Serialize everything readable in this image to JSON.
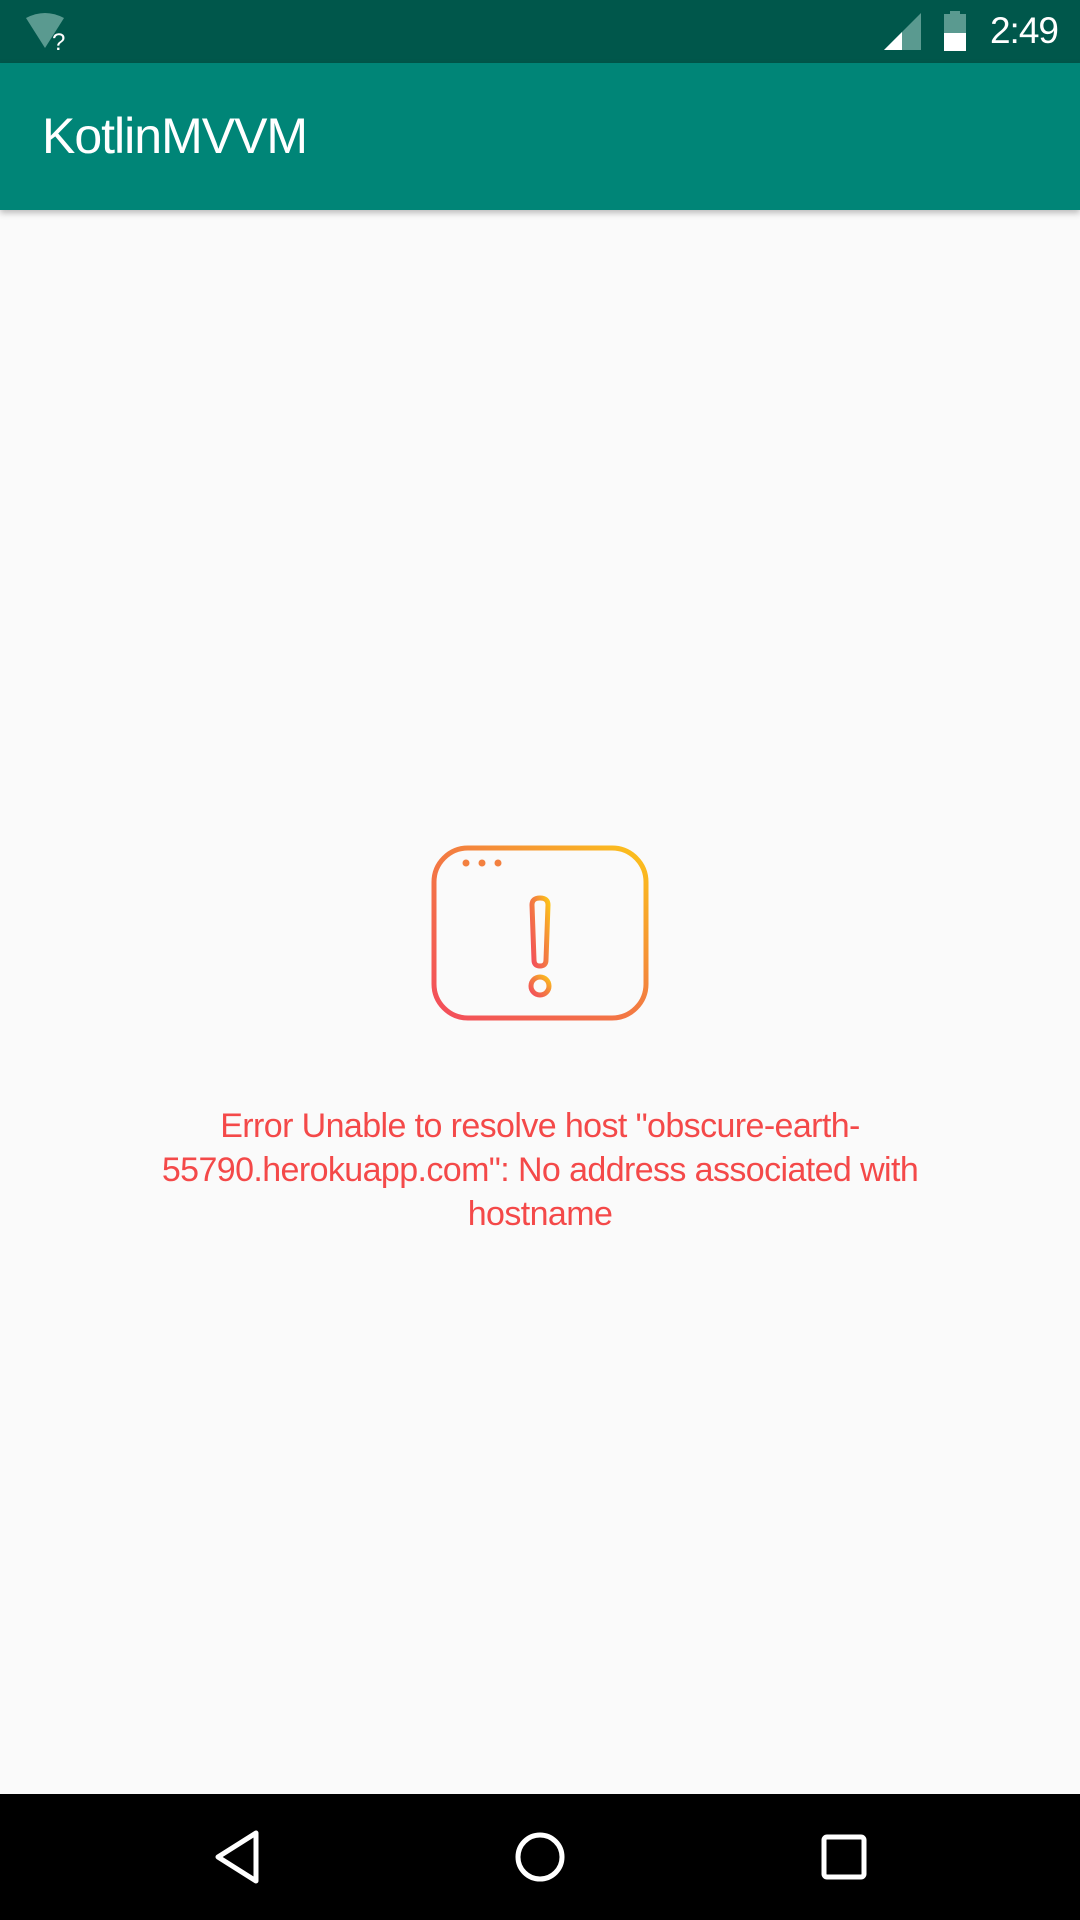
{
  "status_bar": {
    "time": "2:49",
    "icons": [
      "wifi-unknown-icon",
      "signal-icon",
      "battery-icon"
    ]
  },
  "app_bar": {
    "title": "KotlinMVVM",
    "color": "#008577"
  },
  "error": {
    "icon": "browser-warning-icon",
    "message": "Error Unable to resolve host \"obscure-earth-55790.herokuapp.com\": No address associated with hostname",
    "color": "#f44949"
  },
  "nav_bar": {
    "buttons": [
      "back-icon",
      "home-icon",
      "recents-icon"
    ]
  }
}
